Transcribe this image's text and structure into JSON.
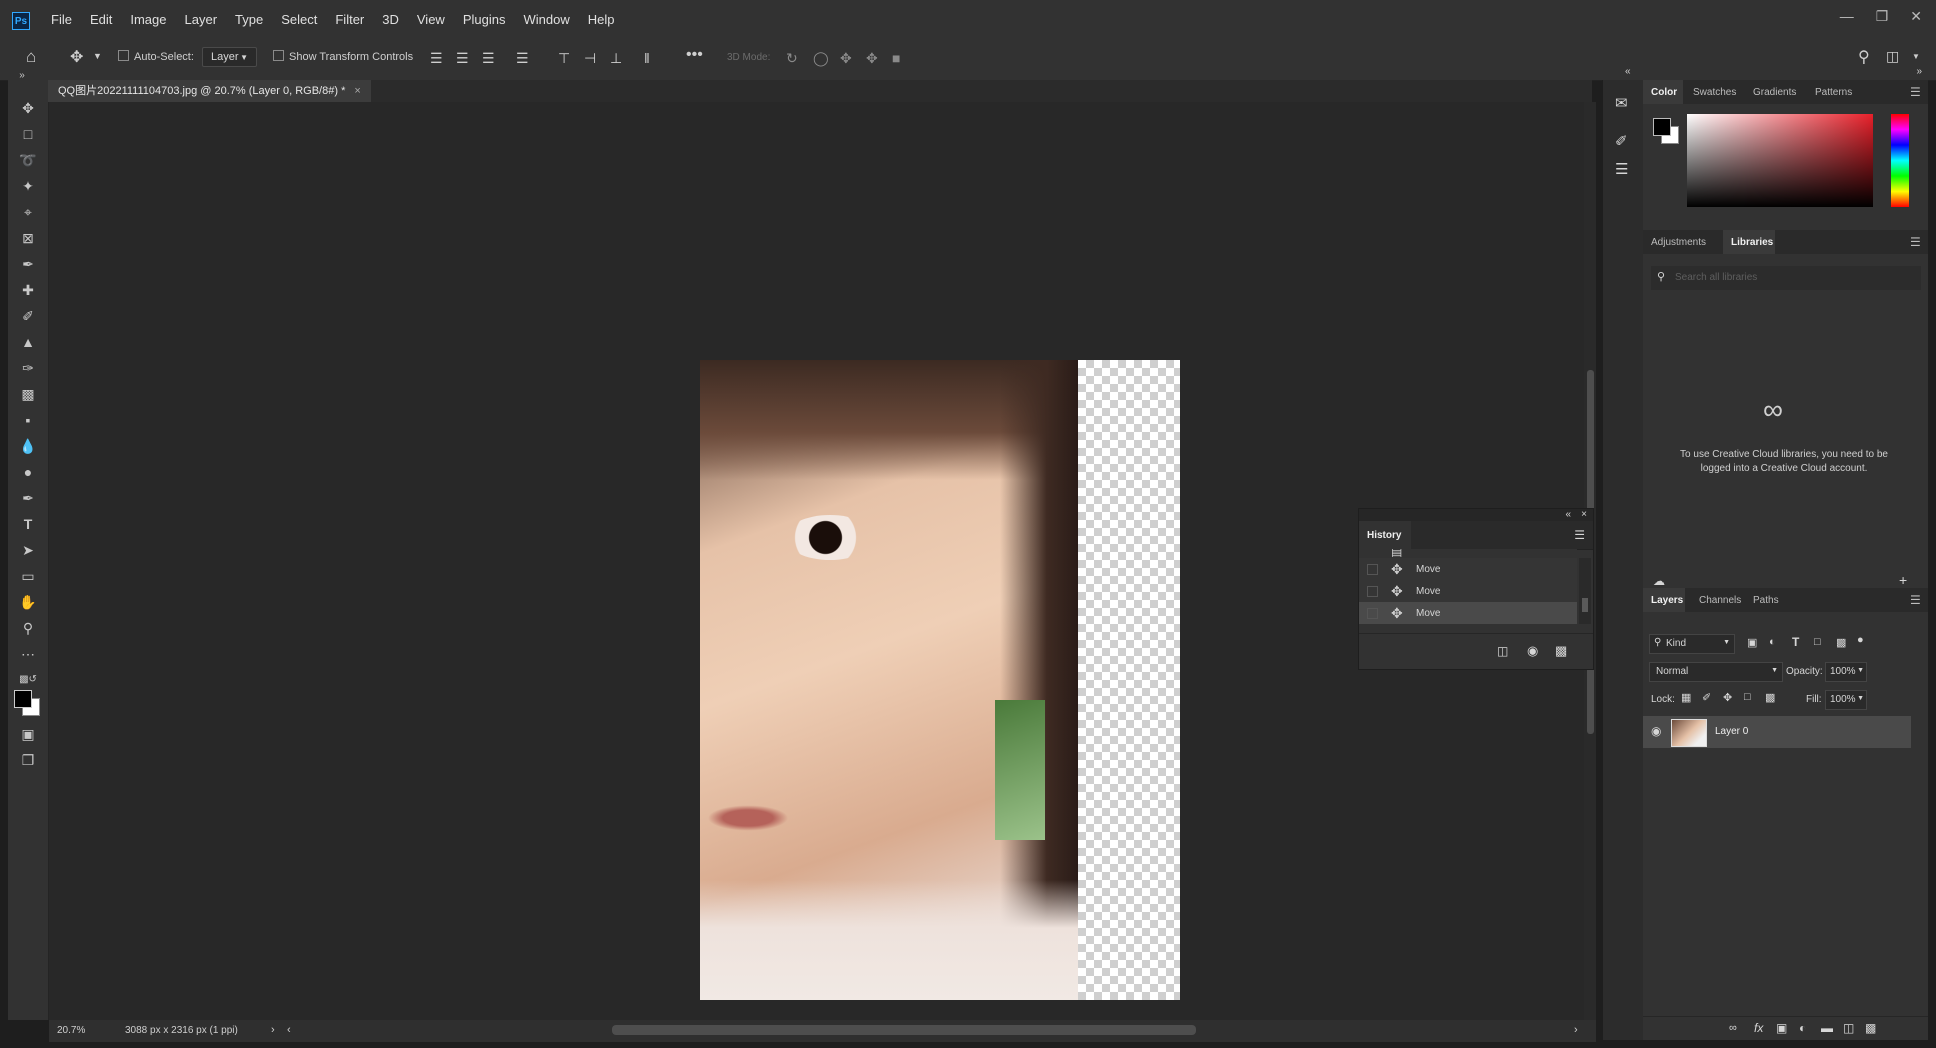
{
  "app": {
    "logo": "Ps"
  },
  "menu": [
    "File",
    "Edit",
    "Image",
    "Layer",
    "Type",
    "Select",
    "Filter",
    "3D",
    "View",
    "Plugins",
    "Window",
    "Help"
  ],
  "options": {
    "auto_select_label": "Auto-Select:",
    "auto_select_value": "Layer",
    "show_transform_label": "Show Transform Controls",
    "mode_3d_label": "3D Mode:"
  },
  "document": {
    "tab_title": "QQ图片20221111104703.jpg @ 20.7% (Layer 0, RGB/8#) *"
  },
  "status": {
    "zoom": "20.7%",
    "dimensions": "3088 px x 2316 px (1 ppi)"
  },
  "history": {
    "title": "History",
    "items": [
      {
        "label": "Move",
        "icon": "move-icon"
      },
      {
        "label": "Move",
        "icon": "move-icon"
      },
      {
        "label": "Move",
        "icon": "move-icon"
      }
    ]
  },
  "color_panel": {
    "tabs": [
      "Color",
      "Swatches",
      "Gradients",
      "Patterns"
    ],
    "active_tab": "Color",
    "foreground": "#000000",
    "background": "#ffffff",
    "hue_color": "#e8202a"
  },
  "libraries_panel": {
    "tabs": [
      "Adjustments",
      "Libraries"
    ],
    "active_tab": "Libraries",
    "search_placeholder": "Search all libraries",
    "message": "To use Creative Cloud libraries, you need to be logged into a Creative Cloud account."
  },
  "layers_panel": {
    "tabs": [
      "Layers",
      "Channels",
      "Paths"
    ],
    "active_tab": "Layers",
    "filter_label": "Kind",
    "blend_mode": "Normal",
    "opacity_label": "Opacity:",
    "opacity_value": "100%",
    "lock_label": "Lock:",
    "fill_label": "Fill:",
    "fill_value": "100%",
    "layers": [
      {
        "name": "Layer 0",
        "visible": true
      }
    ]
  }
}
